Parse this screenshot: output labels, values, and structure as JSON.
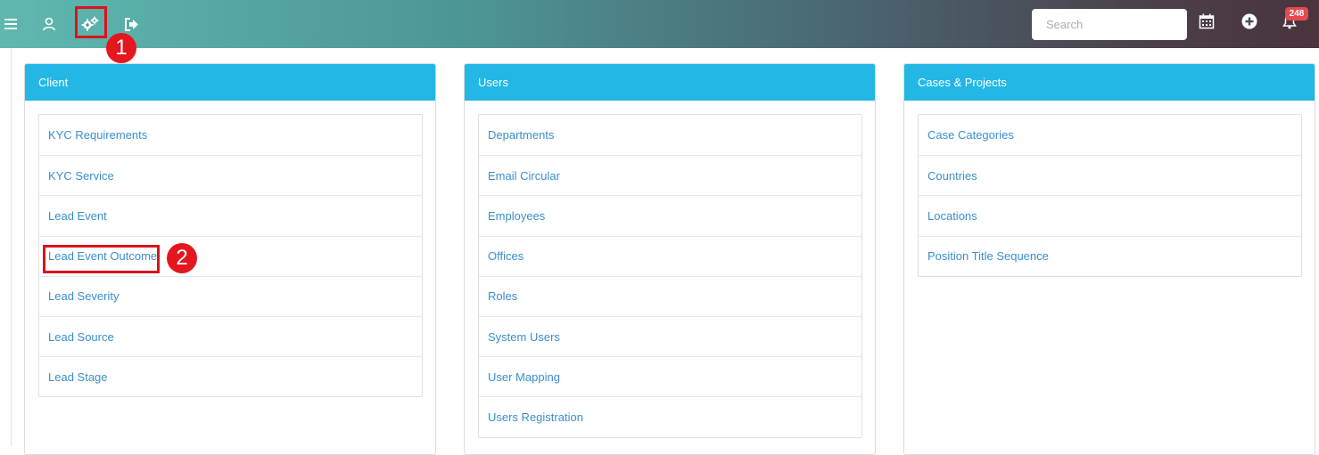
{
  "header": {
    "search_placeholder": "Search",
    "notification_count": "248",
    "icons": [
      "hamburger-menu-icon",
      "user-icon",
      "settings-gears-icon",
      "logout-icon",
      "calendar-icon",
      "plus-circle-icon",
      "bell-icon"
    ]
  },
  "annotations": {
    "step1": "1",
    "step2": "2",
    "highlight_color": "#d8141c"
  },
  "panels": [
    {
      "title": "Client",
      "items": [
        "KYC Requirements",
        "KYC Service",
        "Lead Event",
        "Lead Event Outcome",
        "Lead Severity",
        "Lead Source",
        "Lead Stage"
      ]
    },
    {
      "title": "Users",
      "items": [
        "Departments",
        "Email Circular",
        "Employees",
        "Offices",
        "Roles",
        "System Users",
        "User Mapping",
        "Users Registration"
      ]
    },
    {
      "title": "Cases & Projects",
      "items": [
        "Case Categories",
        "Countries",
        "Locations",
        "Position Title Sequence"
      ]
    }
  ],
  "colors": {
    "panel_header": "#23b7e5",
    "link": "#3a8fd0",
    "badge": "#e54a4f"
  }
}
